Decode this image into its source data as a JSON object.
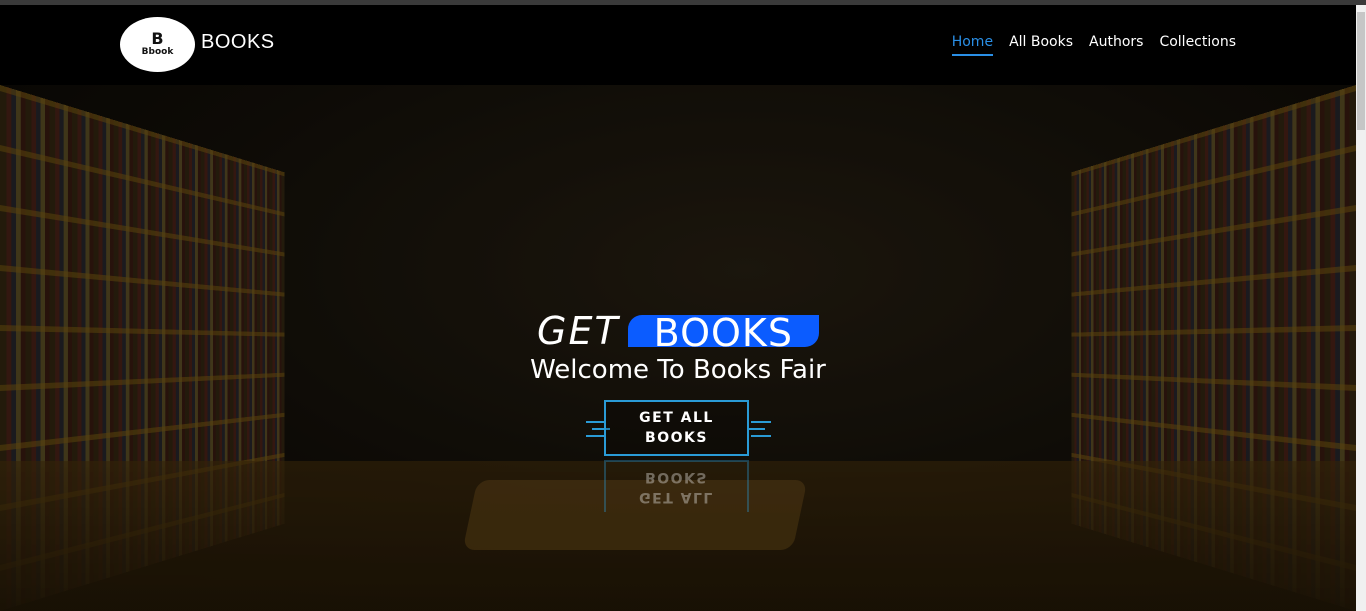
{
  "brand": {
    "logo_mark": "B",
    "logo_text": "Bbook",
    "name": "BOOKS"
  },
  "nav": {
    "items": [
      "Home",
      "All Books",
      "Authors",
      "Collections"
    ],
    "active": "Home",
    "active_color": "#2a8fe6"
  },
  "hero": {
    "title_part1": "GET",
    "title_part2": "BOOKS",
    "subtitle": "Welcome To Books Fair",
    "cta_line1": "GET ALL",
    "cta_line2": "BOOKS",
    "accent_color": "#0b5cff",
    "button_border_color": "#2a9bd6",
    "background": "bookstore-interior-photo"
  }
}
